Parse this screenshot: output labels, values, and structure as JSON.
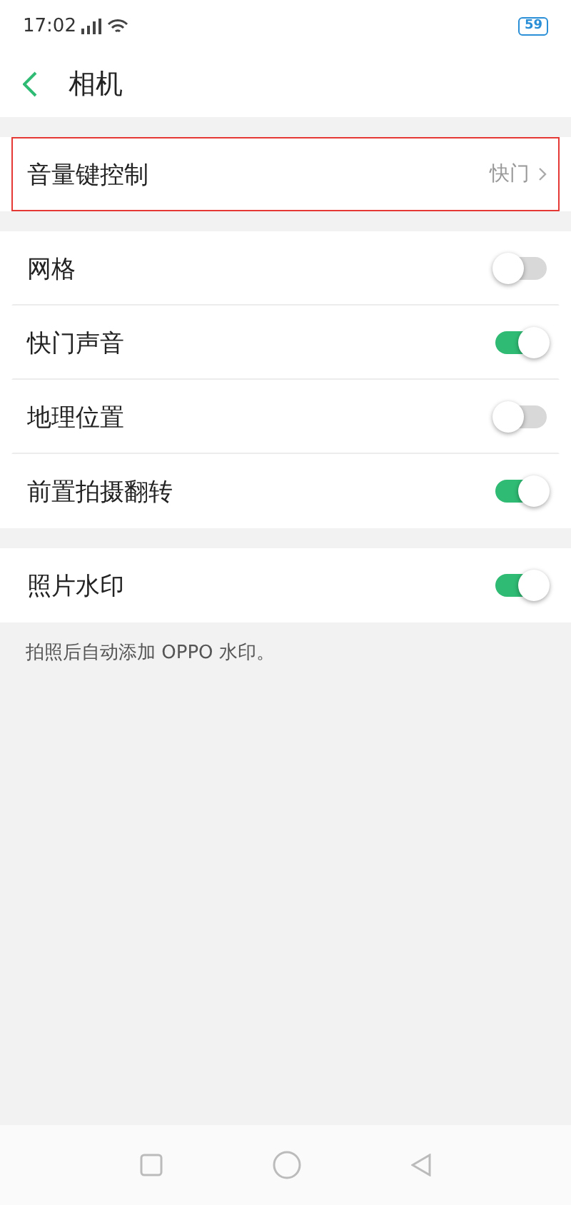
{
  "status_bar": {
    "time": "17:02",
    "battery": "59"
  },
  "header": {
    "title": "相机"
  },
  "sections": [
    {
      "rows": [
        {
          "kind": "link",
          "label": "音量键控制",
          "value": "快门",
          "highlighted": true
        }
      ]
    },
    {
      "rows": [
        {
          "kind": "toggle",
          "label": "网格",
          "on": false
        },
        {
          "kind": "toggle",
          "label": "快门声音",
          "on": true
        },
        {
          "kind": "toggle",
          "label": "地理位置",
          "on": false
        },
        {
          "kind": "toggle",
          "label": "前置拍摄翻转",
          "on": true
        }
      ]
    },
    {
      "rows": [
        {
          "kind": "toggle",
          "label": "照片水印",
          "on": true
        }
      ],
      "footer": "拍照后自动添加 OPPO 水印。"
    }
  ]
}
